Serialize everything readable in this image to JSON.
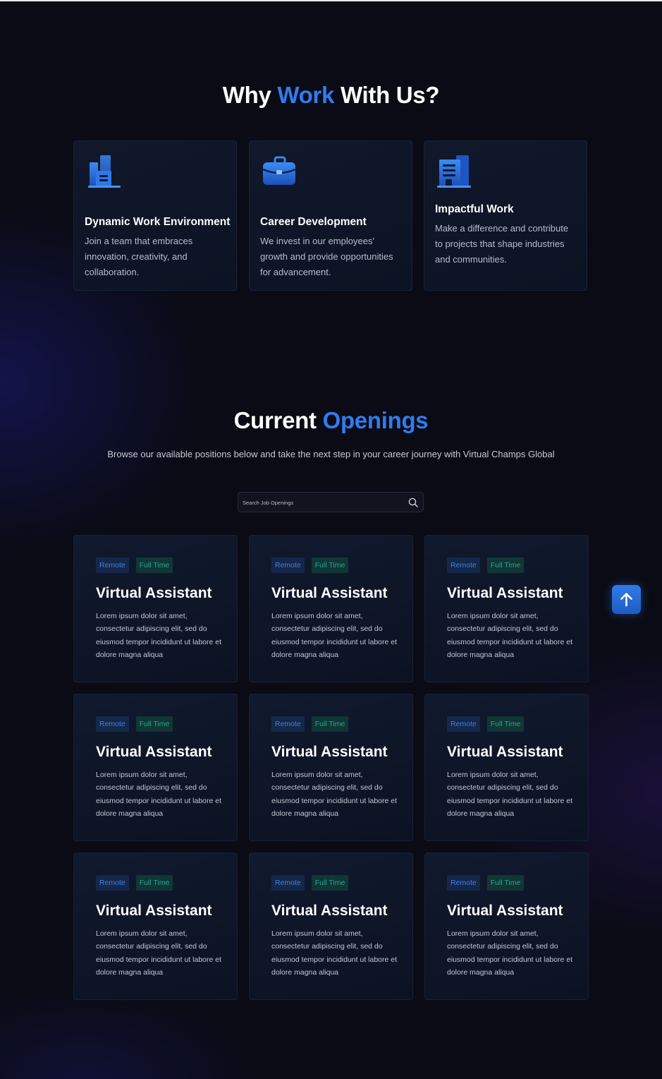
{
  "why": {
    "title_prefix": "Why ",
    "title_accent": "Work",
    "title_suffix": " With Us?",
    "cards": [
      {
        "icon": "office-buildings-icon",
        "title": "Dynamic Work Environment",
        "text": "Join a team that embraces innovation, creativity, and collaboration."
      },
      {
        "icon": "briefcase-icon",
        "title": "Career Development",
        "text": "We invest in our employees' growth and provide opportunities for advancement."
      },
      {
        "icon": "building-icon",
        "title": "Impactful Work",
        "text": "Make a difference and contribute to projects that shape industries and communities."
      }
    ]
  },
  "openings": {
    "title_prefix": "Current ",
    "title_accent": "Openings",
    "subtitle": "Browse our available positions below and take the next step in your career journey with Virtual Champs Global",
    "search_placeholder": "Search Job Openings",
    "jobs": [
      {
        "tag_remote": "Remote",
        "tag_type": "Full Time",
        "title": "Virtual Assistant",
        "desc": "Lorem ipsum dolor sit amet, consectetur adipiscing elit, sed do eiusmod tempor incididunt ut labore et dolore magna aliqua"
      },
      {
        "tag_remote": "Remote",
        "tag_type": "Full Time",
        "title": "Virtual Assistant",
        "desc": "Lorem ipsum dolor sit amet, consectetur adipiscing elit, sed do eiusmod tempor incididunt ut labore et dolore magna aliqua"
      },
      {
        "tag_remote": "Remote",
        "tag_type": "Full Time",
        "title": "Virtual Assistant",
        "desc": "Lorem ipsum dolor sit amet, consectetur adipiscing elit, sed do eiusmod tempor incididunt ut labore et dolore magna aliqua"
      },
      {
        "tag_remote": "Remote",
        "tag_type": "Full Time",
        "title": "Virtual Assistant",
        "desc": "Lorem ipsum dolor sit amet, consectetur adipiscing elit, sed do eiusmod tempor incididunt ut labore et dolore magna aliqua"
      },
      {
        "tag_remote": "Remote",
        "tag_type": "Full Time",
        "title": "Virtual Assistant",
        "desc": "Lorem ipsum dolor sit amet, consectetur adipiscing elit, sed do eiusmod tempor incididunt ut labore et dolore magna aliqua"
      },
      {
        "tag_remote": "Remote",
        "tag_type": "Full Time",
        "title": "Virtual Assistant",
        "desc": "Lorem ipsum dolor sit amet, consectetur adipiscing elit, sed do eiusmod tempor incididunt ut labore et dolore magna aliqua"
      },
      {
        "tag_remote": "Remote",
        "tag_type": "Full Time",
        "title": "Virtual Assistant",
        "desc": "Lorem ipsum dolor sit amet, consectetur adipiscing elit, sed do eiusmod tempor incididunt ut labore et dolore magna aliqua"
      },
      {
        "tag_remote": "Remote",
        "tag_type": "Full Time",
        "title": "Virtual Assistant",
        "desc": "Lorem ipsum dolor sit amet, consectetur adipiscing elit, sed do eiusmod tempor incididunt ut labore et dolore magna aliqua"
      },
      {
        "tag_remote": "Remote",
        "tag_type": "Full Time",
        "title": "Virtual Assistant",
        "desc": "Lorem ipsum dolor sit amet, consectetur adipiscing elit, sed do eiusmod tempor incididunt ut labore et dolore magna aliqua"
      }
    ]
  },
  "scroll_top": {
    "icon": "arrow-up-icon"
  },
  "colors": {
    "background": "#0a0b14",
    "accent": "#2f7cf0",
    "card": "#0f172a",
    "tag_remote_bg": "#15284a",
    "tag_remote_text": "#3f7fe0",
    "tag_fulltime_bg": "#123636",
    "tag_fulltime_text": "#1fa894"
  }
}
